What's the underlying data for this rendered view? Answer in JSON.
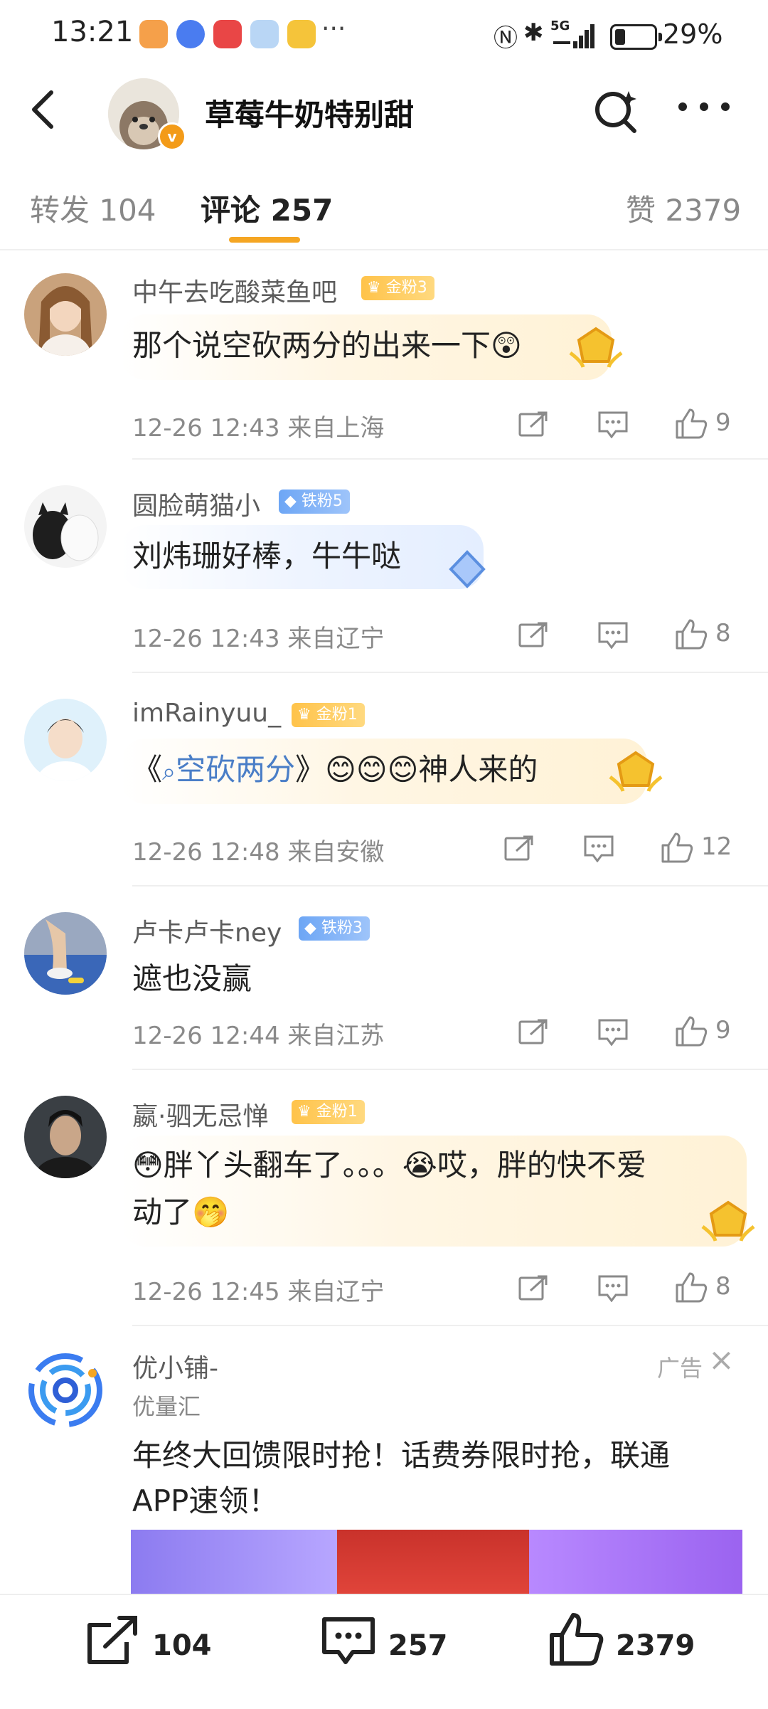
{
  "status_bar": {
    "time": "13:21",
    "more_dots": "···",
    "battery_text": "29%",
    "signal_text": "5G"
  },
  "header": {
    "title": "草莓牛奶特别甜",
    "verified_badge": "v"
  },
  "tabs": [
    {
      "label": "转发 104"
    },
    {
      "label": "评论 257"
    },
    {
      "label": "赞 2379"
    }
  ],
  "comments": [
    {
      "name": "中午去吃酸菜鱼吧",
      "badge": "金粉3",
      "badge_type": "gold",
      "text": "那个说空砍两分的出来一下😲",
      "meta": "12-26 12:43 来自上海",
      "likes": "9"
    },
    {
      "name": "圆脸萌猫小",
      "badge": "铁粉5",
      "badge_type": "iron",
      "text": "刘炜珊好棒，牛牛哒",
      "meta": "12-26 12:43 来自辽宁",
      "likes": "8"
    },
    {
      "name": "imRainyuu_",
      "badge": "金粉1",
      "badge_type": "gold",
      "text_prefix": "《",
      "topic": "空砍两分",
      "text_suffix": "》😊😊😊神人来的",
      "meta": "12-26 12:48 来自安徽",
      "likes": "12"
    },
    {
      "name": "卢卡卢卡ney",
      "badge": "铁粉3",
      "badge_type": "iron",
      "text": "遮也没赢",
      "meta": "12-26 12:44 来自江苏",
      "likes": "9"
    },
    {
      "name": "嬴·驷无忌惮",
      "badge": "金粉1",
      "badge_type": "gold",
      "text_line1": "😳胖丫头翻车了。。。😭哎，胖的快不爱",
      "text_line2": "动了🤭",
      "meta": "12-26 12:45 来自辽宁",
      "likes": "8"
    }
  ],
  "ad": {
    "name": "优小铺-",
    "sub": "优量汇",
    "label": "广告",
    "close": "×",
    "text_line1": "年终大回馈限时抢！话费券限时抢，联通",
    "text_line2": "APP速领！"
  },
  "bottom_bar": {
    "reposts": "104",
    "comments": "257",
    "likes": "2379"
  },
  "colors": {
    "accent": "#f5a623",
    "topic": "#4a7ec7",
    "gold_badge": "#ffc34a",
    "iron_badge": "#6da6f5"
  },
  "icons": [
    "back-icon",
    "search-sparkle-icon",
    "more-icon",
    "share-icon",
    "comment-icon",
    "like-icon"
  ]
}
